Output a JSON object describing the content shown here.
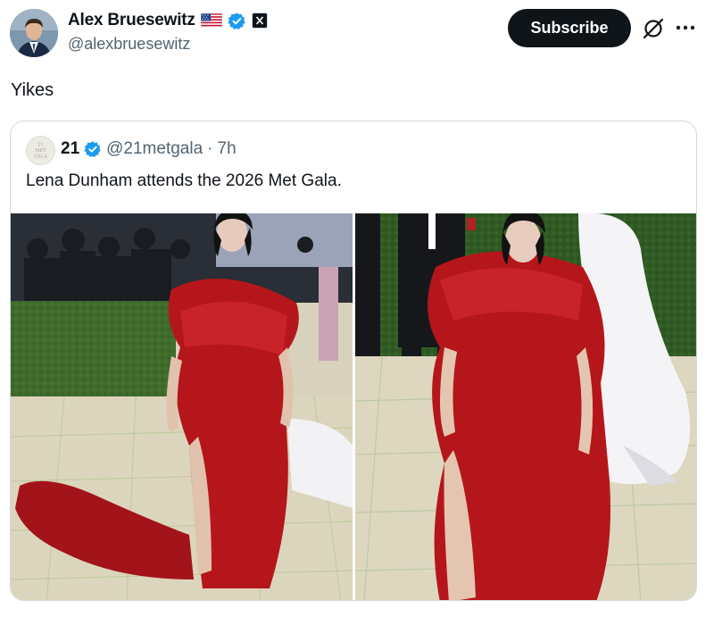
{
  "author": {
    "display_name": "Alex Bruesewitz",
    "handle": "@alexbruesewitz",
    "flag_icon": "us-flag-icon",
    "verified_color": "#1d9bf0"
  },
  "actions": {
    "subscribe_label": "Subscribe"
  },
  "tweet": {
    "text": "Yikes"
  },
  "quote": {
    "display_name": "21",
    "handle": "@21metgala",
    "separator": "·",
    "time": "7h",
    "text": "Lena Dunham attends the 2026 Met Gala."
  },
  "colors": {
    "dark_button": "#0f1419",
    "secondary_text": "#536471",
    "border": "#cfd9de",
    "dress_red": "#b5161c"
  }
}
